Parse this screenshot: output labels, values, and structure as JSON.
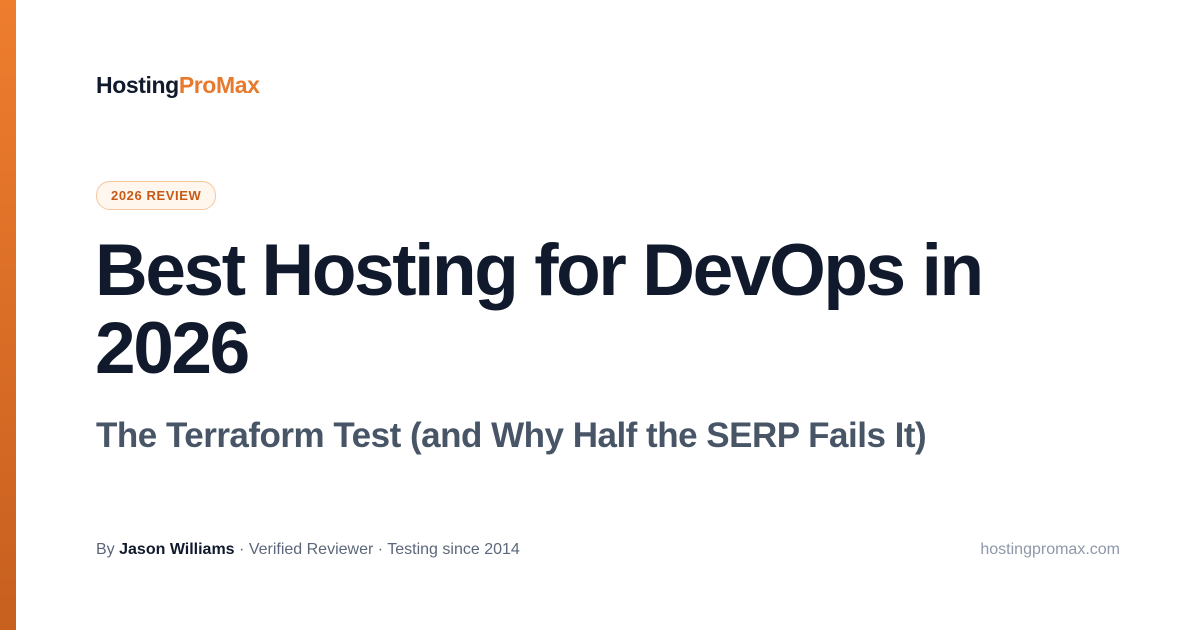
{
  "brand": {
    "name_part1": "Hosting",
    "name_part2": "ProMax",
    "color_dark": "#111a2c",
    "color_accent": "#e87a2e"
  },
  "badge": {
    "label": "2026 REVIEW"
  },
  "title": "Best Hosting for DevOps in 2026",
  "subtitle": "The Terraform Test (and Why Half the SERP Fails It)",
  "byline": {
    "prefix": "By",
    "author": "Jason Williams",
    "separator": "·",
    "role": "Verified Reviewer",
    "experience": "Testing since 2014"
  },
  "site_url": "hostingpromax.com",
  "colors": {
    "accent_bar_top": "#ee7d2e",
    "accent_bar_bottom": "#c75f1f",
    "badge_text": "#c65a16",
    "badge_border": "#f4c79f",
    "badge_bg": "#fff6ee",
    "subtitle": "#485567"
  }
}
